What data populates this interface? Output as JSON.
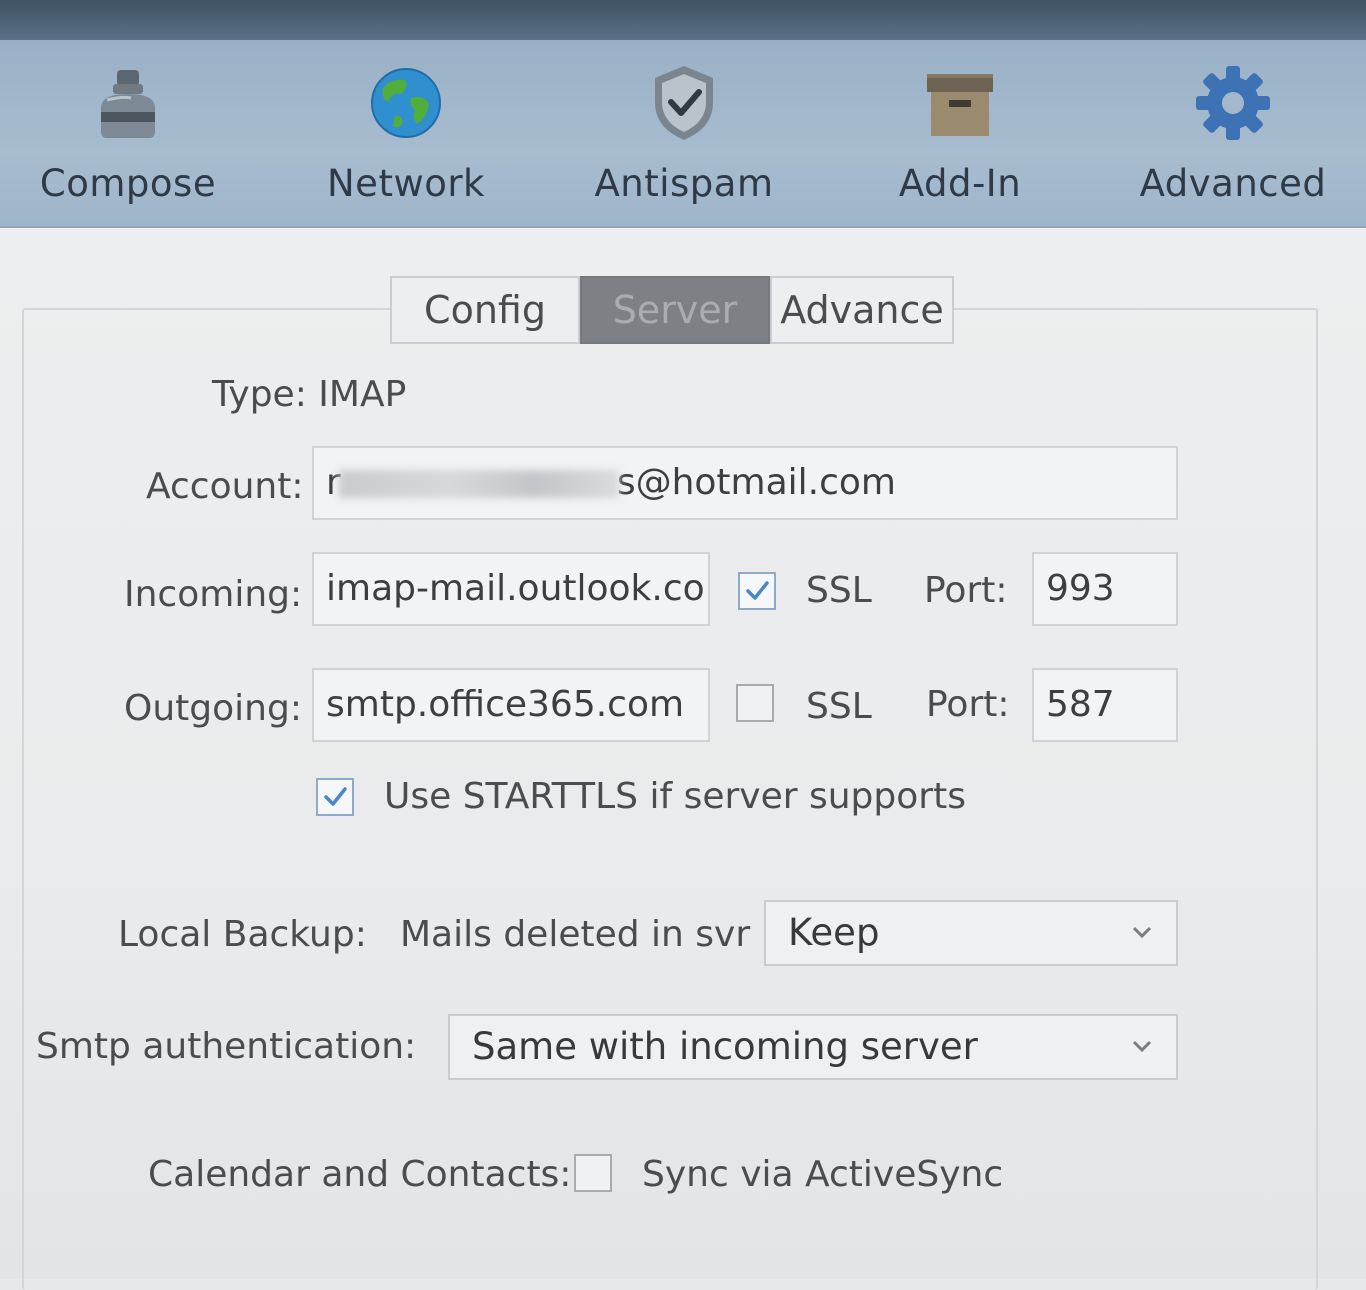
{
  "toolbar": {
    "items": [
      {
        "label": "Compose",
        "icon": "ink-bottle-icon"
      },
      {
        "label": "Network",
        "icon": "globe-icon"
      },
      {
        "label": "Antispam",
        "icon": "shield-check-icon"
      },
      {
        "label": "Add-In",
        "icon": "archive-box-icon"
      },
      {
        "label": "Advanced",
        "icon": "gear-icon"
      }
    ]
  },
  "tabs": {
    "config": "Config",
    "server": "Server",
    "advance": "Advance",
    "active": "Server"
  },
  "server": {
    "type_label": "Type: IMAP",
    "account_label": "Account:",
    "account_prefix": "r",
    "account_suffix": "s@hotmail.com",
    "incoming_label": "Incoming:",
    "incoming_value": "imap-mail.outlook.coi",
    "incoming_ssl_label": "SSL",
    "incoming_ssl_checked": true,
    "incoming_port_label": "Port:",
    "incoming_port": "993",
    "outgoing_label": "Outgoing:",
    "outgoing_value": "smtp.office365.com",
    "outgoing_ssl_label": "SSL",
    "outgoing_ssl_checked": false,
    "outgoing_port_label": "Port:",
    "outgoing_port": "587",
    "starttls_label": "Use STARTTLS if server supports",
    "starttls_checked": true,
    "local_backup_label": "Local Backup:",
    "mails_deleted_label": "Mails deleted in svr",
    "mails_deleted_value": "Keep",
    "smtp_auth_label": "Smtp authentication:",
    "smtp_auth_value": "Same with incoming server",
    "calendar_label": "Calendar and Contacts:",
    "calendar_checked": false,
    "sync_label": "Sync via ActiveSync"
  },
  "colors": {
    "toolbar_bg": "#a3b8cc",
    "titlebar_bg": "#4a5e73",
    "active_tab_bg": "#7d8185",
    "content_bg": "#e9ebec",
    "check_blue": "#4a86c8"
  }
}
